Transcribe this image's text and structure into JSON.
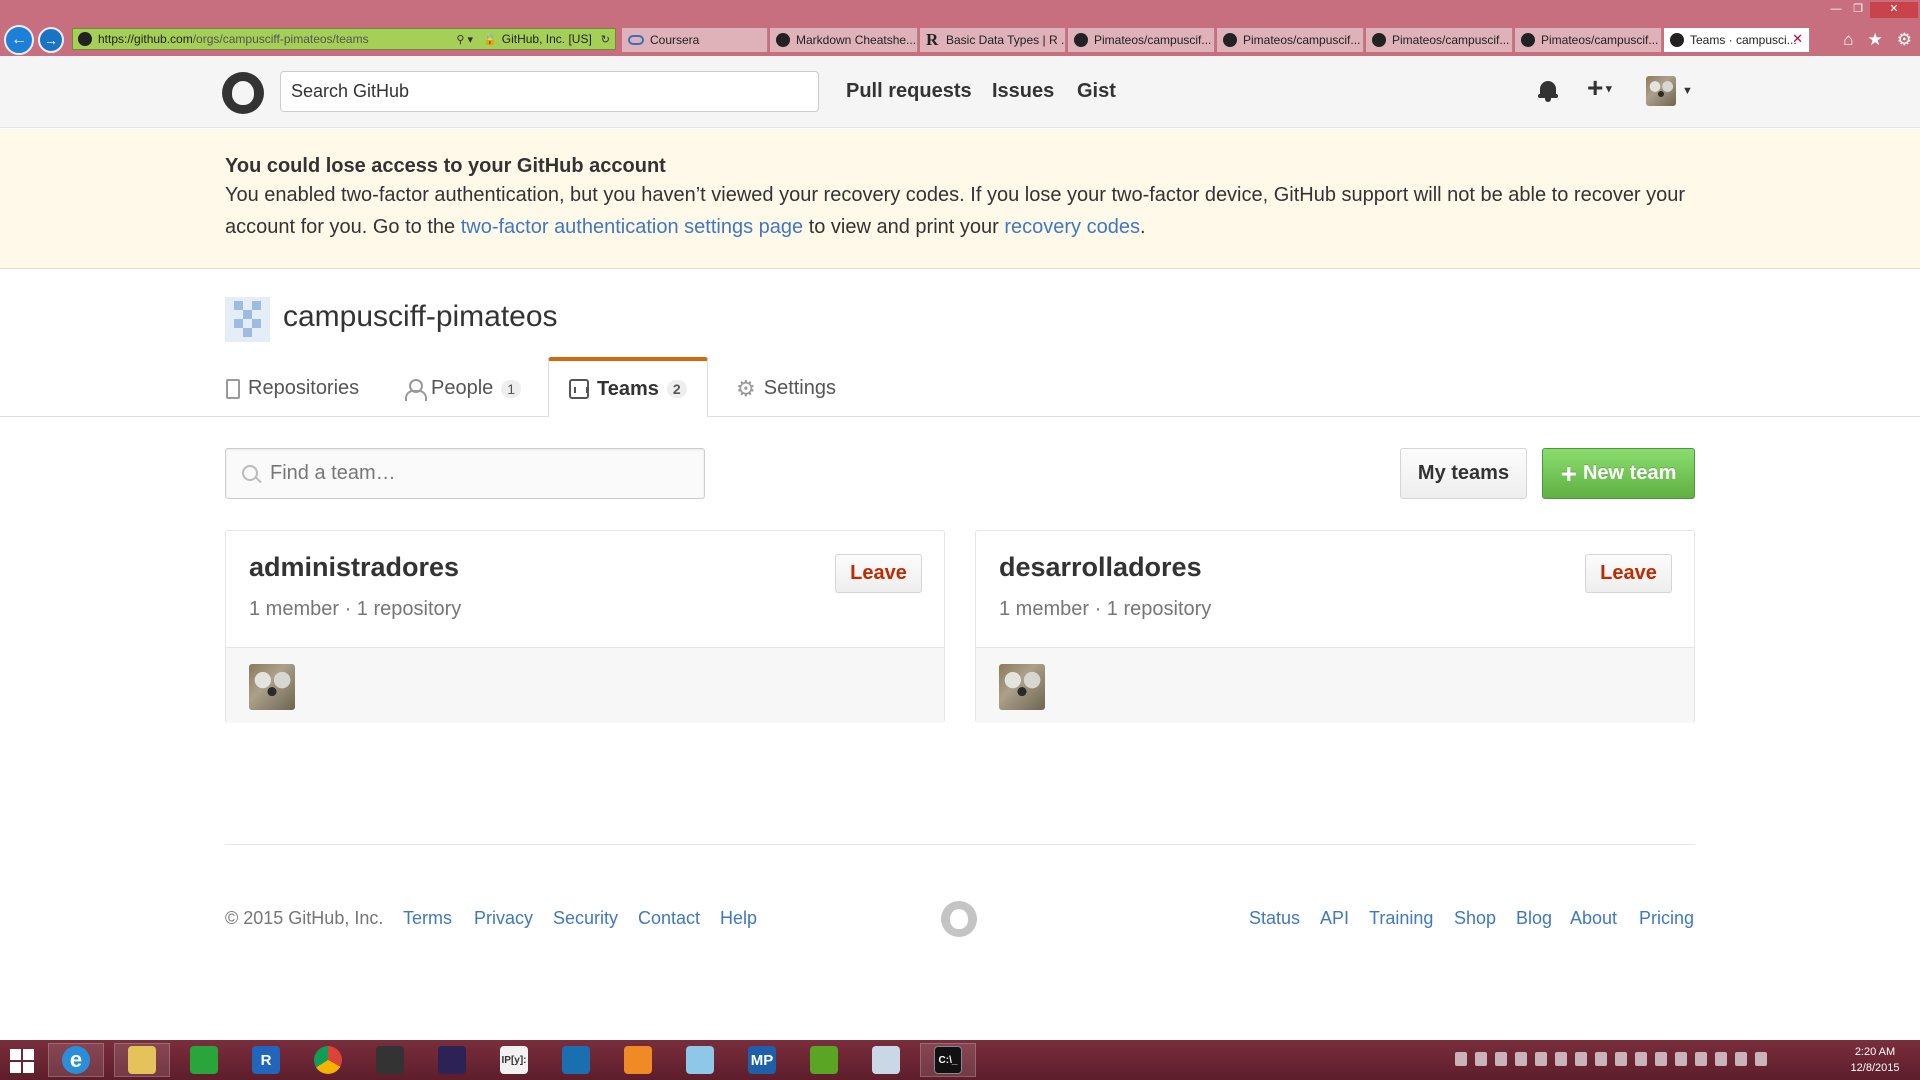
{
  "browser": {
    "url_host": "https://github.com",
    "url_path": "/orgs/campusciff-pimateos/teams",
    "security_label": "GitHub, Inc. [US]",
    "tabs": [
      {
        "label": "Coursera",
        "icon": "coursera-icon"
      },
      {
        "label": "Markdown Cheatshe...",
        "icon": "github-icon"
      },
      {
        "label": "Basic Data Types | R ...",
        "icon": "r-icon"
      },
      {
        "label": "Pimateos/campuscif...",
        "icon": "github-icon"
      },
      {
        "label": "Pimateos/campuscif...",
        "icon": "github-icon"
      },
      {
        "label": "Pimateos/campuscif...",
        "icon": "github-icon"
      },
      {
        "label": "Pimateos/campuscif...",
        "icon": "github-icon"
      },
      {
        "label": "Teams · campusci...",
        "icon": "github-icon",
        "active": true
      }
    ]
  },
  "header": {
    "search_placeholder": "Search GitHub",
    "nav": [
      "Pull requests",
      "Issues",
      "Gist"
    ]
  },
  "flash": {
    "title": "You could lose access to your GitHub account",
    "text_1": "You enabled two-factor authentication, but you haven’t viewed your recovery codes. If you lose your two-factor device, GitHub support will not be able to recover your account for you. Go to the ",
    "link_1": "two-factor authentication settings page",
    "text_2": " to view and print your ",
    "link_2": "recovery codes",
    "text_3": "."
  },
  "org": {
    "name": "campusciff-pimateos",
    "tabs": [
      {
        "label": "Repositories"
      },
      {
        "label": "People",
        "count": "1"
      },
      {
        "label": "Teams",
        "count": "2",
        "selected": true
      },
      {
        "label": "Settings"
      }
    ]
  },
  "teams_page": {
    "find_placeholder": "Find a team…",
    "my_teams_label": "My teams",
    "new_team_label": "New team",
    "teams": [
      {
        "name": "administradores",
        "meta": "1 member · 1 repository",
        "leave_label": "Leave"
      },
      {
        "name": "desarrolladores",
        "meta": "1 member · 1 repository",
        "leave_label": "Leave"
      }
    ]
  },
  "footer": {
    "copyright": "© 2015 GitHub, Inc.",
    "left_links": [
      "Terms",
      "Privacy",
      "Security",
      "Contact",
      "Help"
    ],
    "right_links": [
      "Status",
      "API",
      "Training",
      "Shop",
      "Blog",
      "About",
      "Pricing"
    ]
  },
  "taskbar": {
    "apps": [
      {
        "name": "internet-explorer-icon",
        "glyph": "e",
        "color": "#2a8fd8"
      },
      {
        "name": "file-explorer-icon",
        "glyph": "",
        "color": "#e6c35a"
      },
      {
        "name": "store-icon",
        "glyph": "",
        "color": "#2aa53b"
      },
      {
        "name": "r-app-icon",
        "glyph": "R",
        "color": "#2266bb"
      },
      {
        "name": "chrome-icon",
        "glyph": "",
        "color": "#dd4b39"
      },
      {
        "name": "terminal-icon",
        "glyph": "",
        "color": "#333333"
      },
      {
        "name": "eclipse-icon",
        "glyph": "",
        "color": "#2c2255"
      },
      {
        "name": "ipython-icon",
        "glyph": "IP[y]:",
        "color": "#f2f2f2"
      },
      {
        "name": "speedometer-icon",
        "glyph": "",
        "color": "#1a6fb0"
      },
      {
        "name": "pdf-creator-icon",
        "glyph": "",
        "color": "#f08a24"
      },
      {
        "name": "notepad-icon",
        "glyph": "",
        "color": "#8fc7e8"
      },
      {
        "name": "mp-icon",
        "glyph": "MP",
        "color": "#1d5fa8"
      },
      {
        "name": "evernote-icon",
        "glyph": "",
        "color": "#5ba525"
      },
      {
        "name": "paint-icon",
        "glyph": "",
        "color": "#c9d7e6"
      },
      {
        "name": "cmd-icon",
        "glyph": "C:\\_",
        "color": "#111111"
      }
    ],
    "time": "2:20 AM",
    "date": "12/8/2015"
  }
}
